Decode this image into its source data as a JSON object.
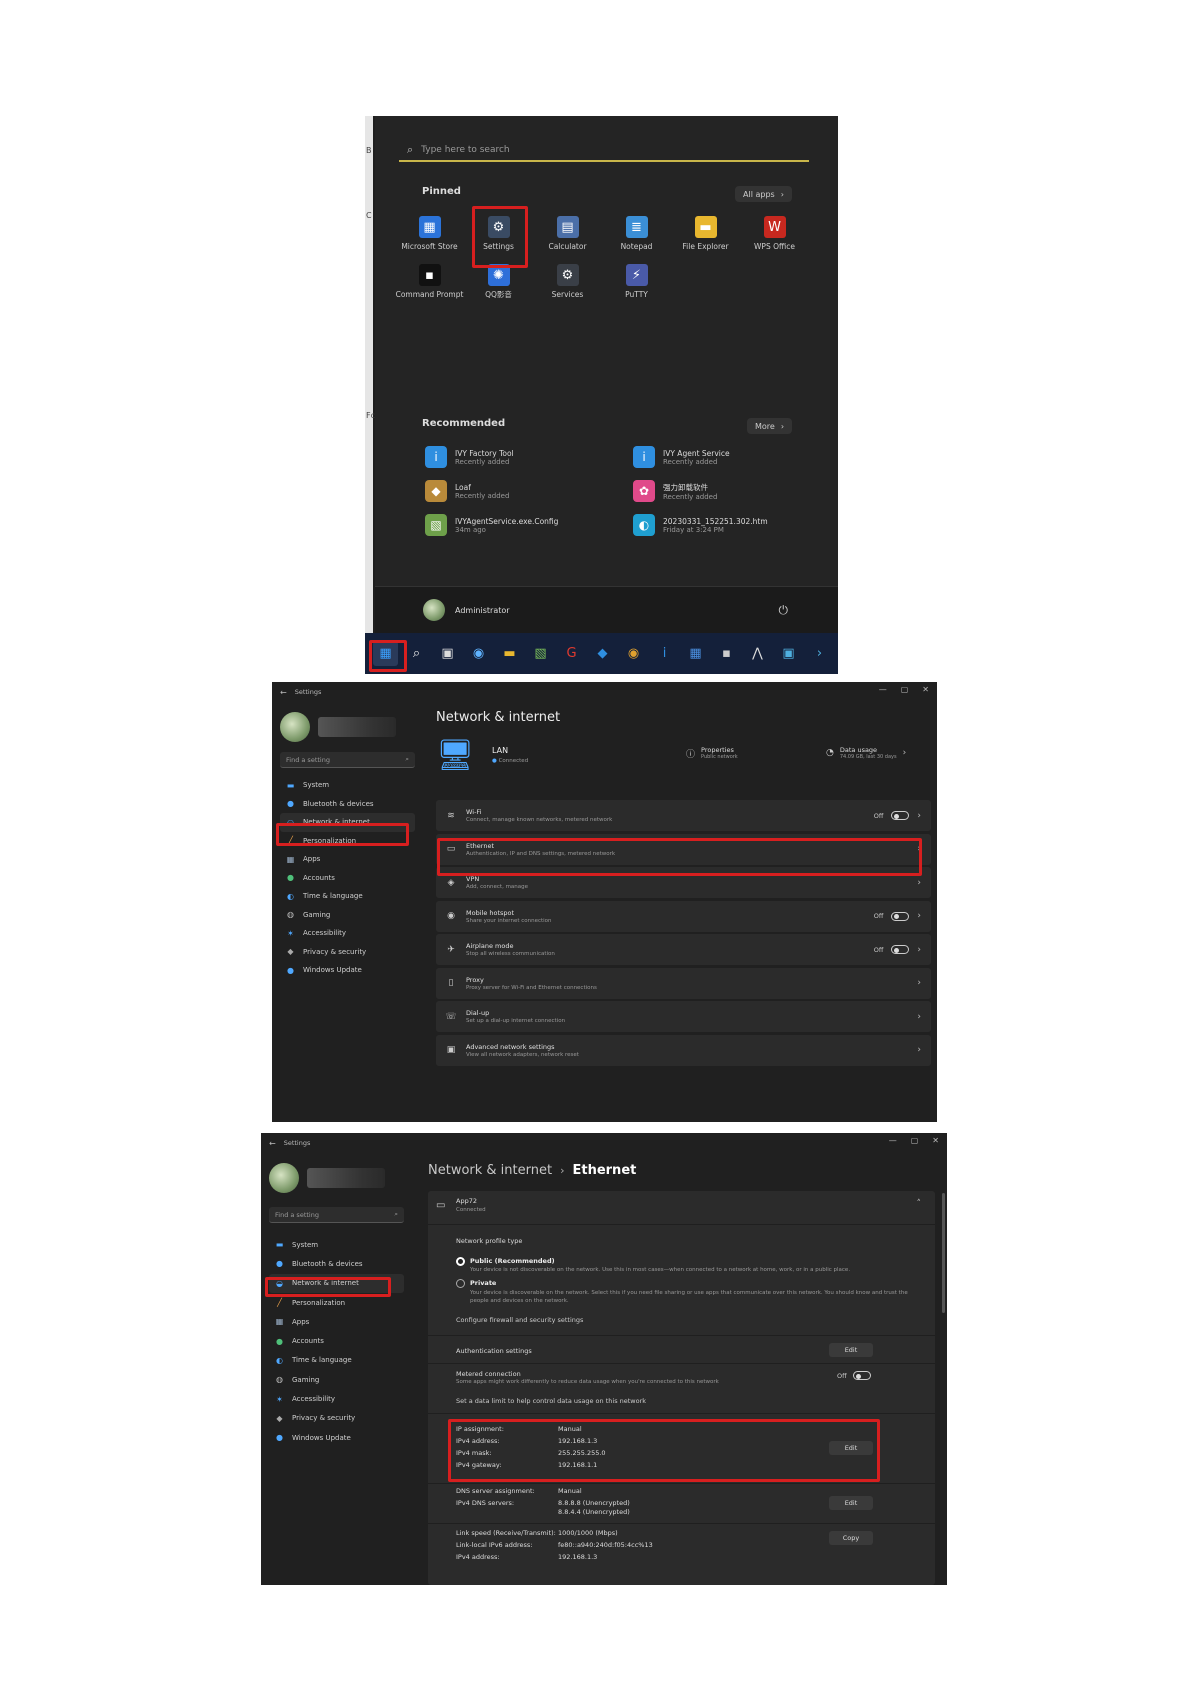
{
  "start_menu": {
    "edge_labels": [
      "B",
      "C",
      "Fc"
    ],
    "search_placeholder": "Type here to search",
    "pinned_label": "Pinned",
    "all_apps_label": "All apps",
    "pinned_apps": [
      {
        "name": "Microsoft Store",
        "icon": "store-icon",
        "color": "#2b73d9",
        "glyph": "▦"
      },
      {
        "name": "Settings",
        "icon": "gear-icon",
        "color": "#3a4b63",
        "glyph": "⚙"
      },
      {
        "name": "Calculator",
        "icon": "calculator-icon",
        "color": "#4b6fa8",
        "glyph": "▤"
      },
      {
        "name": "Notepad",
        "icon": "notepad-icon",
        "color": "#3b8fd6",
        "glyph": "≣"
      },
      {
        "name": "File Explorer",
        "icon": "folder-icon",
        "color": "#e8b72f",
        "glyph": "▬"
      },
      {
        "name": "WPS Office",
        "icon": "wps-icon",
        "color": "#c7281f",
        "glyph": "W"
      },
      {
        "name": "Command Prompt",
        "icon": "terminal-icon",
        "color": "#111111",
        "glyph": "▪"
      },
      {
        "name": "QQ影音",
        "icon": "media-player-icon",
        "color": "#2e6fd9",
        "glyph": "✺"
      },
      {
        "name": "Services",
        "icon": "services-gear-icon",
        "color": "#3a3f47",
        "glyph": "⚙"
      },
      {
        "name": "PuTTY",
        "icon": "putty-icon",
        "color": "#4a5aa8",
        "glyph": "⚡"
      }
    ],
    "recommended_label": "Recommended",
    "more_label": "More",
    "recommended": [
      {
        "name": "IVY Factory Tool",
        "sub": "Recently added",
        "icon": "info-app-icon",
        "color": "#2f8fe0",
        "glyph": "i"
      },
      {
        "name": "IVY Agent Service",
        "sub": "Recently added",
        "icon": "info-app-icon",
        "color": "#2f8fe0",
        "glyph": "i"
      },
      {
        "name": "Loaf",
        "sub": "Recently added",
        "icon": "loaf-icon",
        "color": "#b98a3a",
        "glyph": "◆"
      },
      {
        "name": "强力卸载软件",
        "sub": "Recently added",
        "icon": "uninstaller-icon",
        "color": "#e04a8a",
        "glyph": "✿"
      },
      {
        "name": "IVYAgentService.exe.Config",
        "sub": "34m ago",
        "icon": "config-file-icon",
        "color": "#6ea04a",
        "glyph": "▧"
      },
      {
        "name": "20230331_152251.302.htm",
        "sub": "Friday at 3:24 PM",
        "icon": "edge-icon",
        "color": "#1f9fd0",
        "glyph": "◐"
      }
    ],
    "user_name": "Administrator",
    "taskbar_icons": [
      {
        "icon": "windows-start-icon",
        "glyph": "▦",
        "color": "#3aa0ff"
      },
      {
        "icon": "search-icon",
        "glyph": "⌕",
        "color": "#eeeeee"
      },
      {
        "icon": "task-view-icon",
        "glyph": "▣",
        "color": "#dddddd"
      },
      {
        "icon": "widgets-icon",
        "glyph": "◉",
        "color": "#5fb3ff"
      },
      {
        "icon": "file-explorer-icon",
        "glyph": "▬",
        "color": "#e8b72f"
      },
      {
        "icon": "notepad-icon",
        "glyph": "▧",
        "color": "#7bbf5a"
      },
      {
        "icon": "app-red-icon",
        "glyph": "G",
        "color": "#e23a2f"
      },
      {
        "icon": "app-blue-icon",
        "glyph": "◆",
        "color": "#2f8fe0"
      },
      {
        "icon": "chrome-icon",
        "glyph": "◉",
        "color": "#e0a12f"
      },
      {
        "icon": "info-app-icon",
        "glyph": "i",
        "color": "#2f8fe0"
      },
      {
        "icon": "app-grid-icon",
        "glyph": "▦",
        "color": "#4a8fe0"
      },
      {
        "icon": "terminal-icon",
        "glyph": "▪",
        "color": "#cccccc"
      },
      {
        "icon": "app-tool-icon",
        "glyph": "⋀",
        "color": "#dddddd"
      },
      {
        "icon": "app-monitor-icon",
        "glyph": "▣",
        "color": "#4fb0e0"
      },
      {
        "icon": "more-icon",
        "glyph": "›",
        "color": "#4fb0e0"
      }
    ]
  },
  "settings_nav": {
    "app_title": "Settings",
    "find_placeholder": "Find a setting",
    "items": [
      {
        "label": "System",
        "icon": "system-icon",
        "glyph": "▬",
        "color": "#4fa8ff"
      },
      {
        "label": "Bluetooth & devices",
        "icon": "bluetooth-icon",
        "glyph": "●",
        "color": "#4fa8ff"
      },
      {
        "label": "Network & internet",
        "icon": "network-icon",
        "glyph": "◒",
        "color": "#4fa8ff"
      },
      {
        "label": "Personalization",
        "icon": "brush-icon",
        "glyph": "╱",
        "color": "#e8a04a"
      },
      {
        "label": "Apps",
        "icon": "apps-icon",
        "glyph": "▦",
        "color": "#9ab0c8"
      },
      {
        "label": "Accounts",
        "icon": "account-icon",
        "glyph": "●",
        "color": "#4fc07a"
      },
      {
        "label": "Time & language",
        "icon": "globe-icon",
        "glyph": "◐",
        "color": "#4fa8ff"
      },
      {
        "label": "Gaming",
        "icon": "gaming-icon",
        "glyph": "◍",
        "color": "#bbbbbb"
      },
      {
        "label": "Accessibility",
        "icon": "accessibility-icon",
        "glyph": "✶",
        "color": "#4fa8ff"
      },
      {
        "label": "Privacy & security",
        "icon": "shield-icon",
        "glyph": "◆",
        "color": "#aaaaaa"
      },
      {
        "label": "Windows Update",
        "icon": "update-icon",
        "glyph": "●",
        "color": "#4fa8ff"
      }
    ]
  },
  "network_page": {
    "title": "Network & internet",
    "lan_name": "LAN",
    "lan_status": "Connected",
    "properties_title": "Properties",
    "properties_sub": "Public network",
    "data_usage_title": "Data usage",
    "data_usage_sub": "74.09 GB, last 30 days",
    "off_label": "Off",
    "rows": [
      {
        "title": "Wi-Fi",
        "sub": "Connect, manage known networks, metered network",
        "icon": "wifi-icon",
        "glyph": "≋",
        "toggle": true
      },
      {
        "title": "Ethernet",
        "sub": "Authentication, IP and DNS settings, metered network",
        "icon": "ethernet-icon",
        "glyph": "▭",
        "toggle": false
      },
      {
        "title": "VPN",
        "sub": "Add, connect, manage",
        "icon": "vpn-shield-icon",
        "glyph": "◈",
        "toggle": false
      },
      {
        "title": "Mobile hotspot",
        "sub": "Share your internet connection",
        "icon": "hotspot-icon",
        "glyph": "◉",
        "toggle": true
      },
      {
        "title": "Airplane mode",
        "sub": "Stop all wireless communication",
        "icon": "airplane-icon",
        "glyph": "✈",
        "toggle": true
      },
      {
        "title": "Proxy",
        "sub": "Proxy server for Wi-Fi and Ethernet connections",
        "icon": "proxy-icon",
        "glyph": "▯",
        "toggle": false
      },
      {
        "title": "Dial-up",
        "sub": "Set up a dial-up internet connection",
        "icon": "dialup-icon",
        "glyph": "☏",
        "toggle": false
      },
      {
        "title": "Advanced network settings",
        "sub": "View all network adapters, network reset",
        "icon": "advanced-network-icon",
        "glyph": "▣",
        "toggle": false
      }
    ]
  },
  "ethernet_page": {
    "breadcrumb_parent": "Network & internet",
    "breadcrumb_sep": "›",
    "breadcrumb_current": "Ethernet",
    "adapter_name": "App72",
    "adapter_status": "Connected",
    "profile_type_label": "Network profile type",
    "public_label": "Public (Recommended)",
    "public_desc": "Your device is not discoverable on the network. Use this in most cases—when connected to a network at home, work, or in a public place.",
    "private_label": "Private",
    "private_desc": "Your device is discoverable on the network. Select this if you need file sharing or use apps that communicate over this network. You should know and trust the people and devices on the network.",
    "firewall_link": "Configure firewall and security settings",
    "auth_label": "Authentication settings",
    "edit_label": "Edit",
    "copy_label": "Copy",
    "off_label": "Off",
    "metered_title": "Metered connection",
    "metered_desc": "Some apps might work differently to reduce data usage when you're connected to this network",
    "data_limit_link": "Set a data limit to help control data usage on this network",
    "ip_assignment_label": "IP assignment:",
    "ip_assignment_value": "Manual",
    "ipv4_address_label": "IPv4 address:",
    "ipv4_address_value": "192.168.1.3",
    "ipv4_mask_label": "IPv4 mask:",
    "ipv4_mask_value": "255.255.255.0",
    "ipv4_gateway_label": "IPv4 gateway:",
    "ipv4_gateway_value": "192.168.1.1",
    "dns_assignment_label": "DNS server assignment:",
    "dns_assignment_value": "Manual",
    "ipv4_dns_label": "IPv4 DNS servers:",
    "ipv4_dns_value_1": "8.8.8.8 (Unencrypted)",
    "ipv4_dns_value_2": "8.8.4.4 (Unencrypted)",
    "link_speed_label": "Link speed (Receive/Transmit):",
    "link_speed_value": "1000/1000 (Mbps)",
    "link_local_label": "Link-local IPv6 address:",
    "link_local_value": "fe80::a940:240d:f05:4cc%13",
    "ipv4_address2_label": "IPv4 address:",
    "ipv4_address2_value": "192.168.1.3"
  }
}
